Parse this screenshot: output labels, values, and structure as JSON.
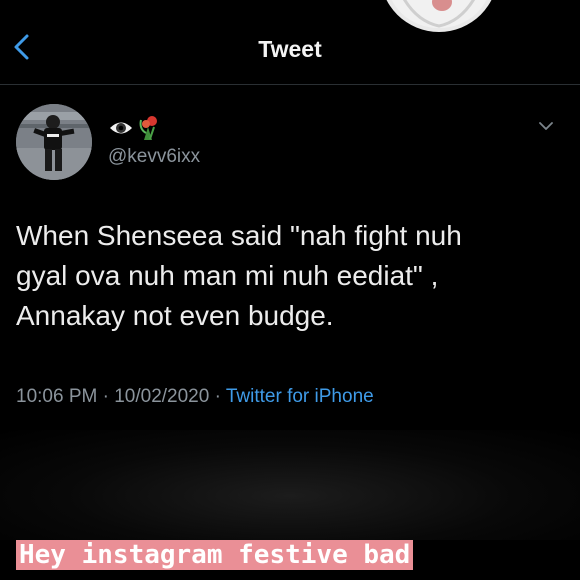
{
  "header": {
    "title": "Tweet",
    "back_icon": "chevron-left-icon"
  },
  "author": {
    "name_emojis": [
      "eye-emoji",
      "bouquet-emoji"
    ],
    "handle": "@kevv6ixx"
  },
  "tweet": {
    "lines": [
      "When Shenseea said \"nah fight nuh",
      "gyal ova nuh man mi nuh eediat\" ,",
      "Annakay not even budge."
    ],
    "time": "10:06 PM",
    "date": "10/02/2020",
    "separator": "·",
    "source": "Twitter for iPhone"
  },
  "story_caption": "Hey instagram festive bad",
  "colors": {
    "background": "#000000",
    "link": "#3f9be8",
    "muted": "#8b949c",
    "caption_bg": "#ea8f96"
  }
}
